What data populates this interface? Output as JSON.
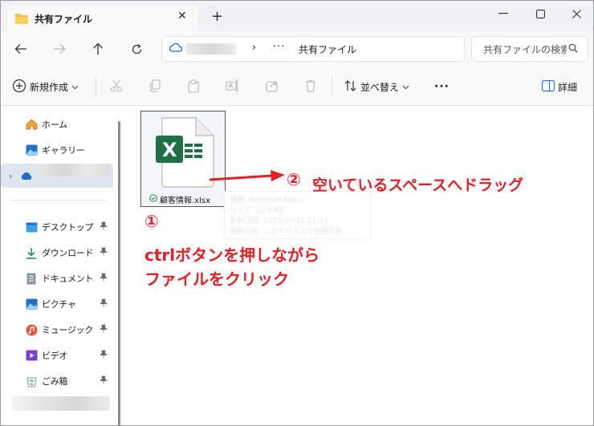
{
  "tab": {
    "title": "共有ファイル",
    "close": "✕",
    "new": "+"
  },
  "window_controls": {
    "minimize": "—",
    "maximize": "☐",
    "close": "✕"
  },
  "address": {
    "chevron": "›",
    "dots": "···",
    "current": "共有ファイル"
  },
  "search": {
    "placeholder": "共有ファイルの検索"
  },
  "commands": {
    "new_label": "新規作成",
    "sort_label": "並べ替え",
    "more": "···",
    "details_label": "詳細"
  },
  "sidebar": {
    "items": [
      {
        "label": "ホーム"
      },
      {
        "label": "ギャラリー"
      },
      {
        "label": "デスクトップ"
      },
      {
        "label": "ダウンロード"
      },
      {
        "label": "ドキュメント"
      },
      {
        "label": "ピクチャ"
      },
      {
        "label": "ミュージック"
      },
      {
        "label": "ビデオ"
      },
      {
        "label": "ごみ箱"
      }
    ]
  },
  "file": {
    "name": "顧客情報.xlsx",
    "excel_letter": "X"
  },
  "annotations": {
    "step1_num": "①",
    "step1_line1": "ctrlボタンを押しながら",
    "step1_line2": "ファイルをクリック",
    "step2_num": "②",
    "step2_text": "空いているスペースへドラッグ",
    "accent": "#e81e25"
  }
}
